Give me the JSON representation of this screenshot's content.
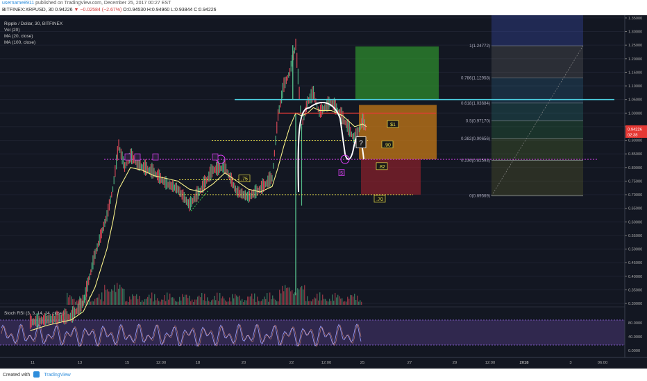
{
  "header": {
    "user": "username8911",
    "published": "published on TradingView.com, December 25, 2017 00:27 EST",
    "symbol_line": "BITFINEX:XRPUSD, 30",
    "last": "0.94226",
    "change": "−0.02584 (−2.67%)",
    "ohlc": "O:0.94530 H:0.94960 L:0.93844 C:0.94226"
  },
  "legend": {
    "title": "Ripple / Dollar, 30, BITFINEX",
    "vol": "Vol (20)",
    "ma20": "MA (20, close)",
    "ma100": "MA (100, close)"
  },
  "stoch_label": "Stoch RSI (3, 3, 14, 14, close)",
  "footer": {
    "created": "Created with",
    "brand": "TradingView"
  },
  "price_badge": {
    "price": "0.94226",
    "timer": "02:38"
  },
  "colors": {
    "bg": "#131722",
    "up": "#53b987",
    "down": "#eb4d5c",
    "ma20": "#f7f08a",
    "cyan": "#4dd0e1",
    "pink": "#e040fb",
    "yellow": "#e8e04a",
    "stoch": "#7e57c2"
  },
  "chart_data": {
    "type": "line",
    "title": "Ripple / Dollar, 30, BITFINEX",
    "y_axis": {
      "ticks": [
        "1.35000",
        "1.30000",
        "1.25000",
        "1.20000",
        "1.15000",
        "1.10000",
        "1.05000",
        "1.00000",
        "0.95000",
        "0.90000",
        "0.85000",
        "0.80000",
        "0.75000",
        "0.70000",
        "0.65000",
        "0.60000",
        "0.55000",
        "0.50000",
        "0.45000",
        "0.40000",
        "0.35000",
        "0.30000"
      ],
      "range": [
        0.295,
        1.36
      ]
    },
    "x_axis": {
      "ticks": [
        "11",
        "13",
        "15",
        "12:00",
        "18",
        "20",
        "22",
        "12:00",
        "25",
        "27",
        "29",
        "12:00",
        "2018",
        "3",
        "06:00"
      ]
    },
    "stoch_axis": {
      "ticks": [
        "80.0000",
        "40.0000",
        "0.0000"
      ]
    },
    "price_series": {
      "x": [
        "Dec 10 18:00",
        "Dec 11 12:00",
        "Dec 12 12:00",
        "Dec 13 00:00",
        "Dec 13 12:00",
        "Dec 14 00:00",
        "Dec 14 06:00",
        "Dec 14 12:00",
        "Dec 14 18:00",
        "Dec 15 00:00",
        "Dec 15 12:00",
        "Dec 16 00:00",
        "Dec 16 12:00",
        "Dec 17 00:00",
        "Dec 17 12:00",
        "Dec 18 00:00",
        "Dec 18 12:00",
        "Dec 19 00:00",
        "Dec 19 12:00",
        "Dec 20 00:00",
        "Dec 20 12:00",
        "Dec 21 00:00",
        "Dec 21 06:00",
        "Dec 21 12:00",
        "Dec 21 18:00",
        "Dec 22 00:00",
        "Dec 22 06:00",
        "Dec 22 12:00",
        "Dec 22 18:00",
        "Dec 23 00:00",
        "Dec 23 12:00",
        "Dec 24 00:00",
        "Dec 24 12:00",
        "Dec 24 20:00",
        "Dec 25 00:00"
      ],
      "y": [
        0.23,
        0.24,
        0.25,
        0.3,
        0.48,
        0.62,
        0.72,
        0.88,
        0.8,
        0.84,
        0.8,
        0.78,
        0.74,
        0.72,
        0.66,
        0.72,
        0.79,
        0.8,
        0.71,
        0.69,
        0.72,
        0.76,
        0.99,
        1.1,
        1.15,
        1.25,
        0.95,
        1.04,
        1.07,
        1.0,
        1.04,
        0.98,
        0.9,
        0.97,
        0.94
      ]
    },
    "ma20": [
      0.2,
      0.22,
      0.24,
      0.27,
      0.36,
      0.5,
      0.6,
      0.72,
      0.76,
      0.8,
      0.79,
      0.77,
      0.76,
      0.75,
      0.72,
      0.71,
      0.74,
      0.78,
      0.75,
      0.72,
      0.71,
      0.73,
      0.8,
      0.88,
      0.95,
      1.0,
      0.99,
      1.0,
      1.02,
      1.01,
      1.01,
      0.99,
      0.95,
      0.96,
      0.95
    ],
    "annotations": {
      "resistance_cyan": 1.05,
      "red_line": 1.0,
      "pink_dotted": 0.83,
      "yellow_dotted_high": 0.9,
      "yellow_dotted_low": 0.7,
      "labels": [
        {
          "text": "$1",
          "price": 0.96
        },
        {
          "text": ".90",
          "price": 0.885
        },
        {
          "text": ".82",
          "price": 0.805
        },
        {
          "text": ".75",
          "price": 0.76
        },
        {
          "text": ".70",
          "price": 0.685
        }
      ],
      "fib_levels": [
        {
          "label": "1(1.24772)",
          "price": 1.24772
        },
        {
          "label": "0.786(1.12958)",
          "price": 1.12958
        },
        {
          "label": "0.618(1.03684)",
          "price": 1.03684
        },
        {
          "label": "0.5(0.97170)",
          "price": 0.9717
        },
        {
          "label": "0.382(0.90656)",
          "price": 0.90656
        },
        {
          "label": "0.236(0.82593)",
          "price": 0.82593
        },
        {
          "label": "0(0.69569)",
          "price": 0.69569
        }
      ],
      "markers": [
        "?",
        "5"
      ]
    }
  }
}
